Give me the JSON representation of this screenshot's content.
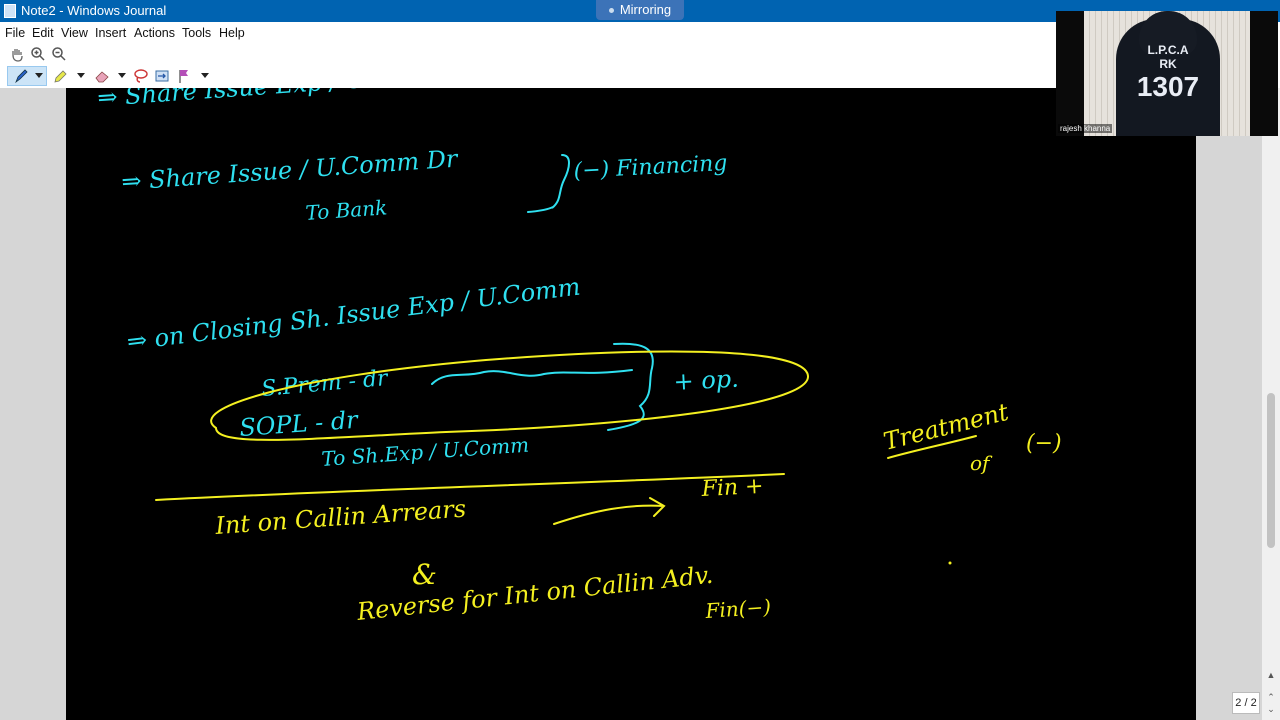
{
  "window": {
    "title": "Note2 - Windows Journal",
    "mirroring_label": "Mirroring"
  },
  "menu": [
    "File",
    "Edit",
    "View",
    "Insert",
    "Actions",
    "Tools",
    "Help"
  ],
  "toolbar1": [
    {
      "icon": "hand-pan-icon"
    },
    {
      "icon": "zoom-in-icon"
    },
    {
      "icon": "zoom-out-icon"
    }
  ],
  "toolbar2": [
    {
      "icon": "pen-icon"
    },
    {
      "icon": "pen-dropdown-icon"
    },
    {
      "icon": "highlighter-icon"
    },
    {
      "icon": "highlighter-dropdown-icon"
    },
    {
      "icon": "eraser-icon"
    },
    {
      "icon": "eraser-dropdown-icon"
    },
    {
      "icon": "lasso-select-icon"
    },
    {
      "icon": "insert-space-icon"
    },
    {
      "icon": "flag-icon"
    },
    {
      "icon": "flag-dropdown-icon"
    }
  ],
  "video": {
    "hoodie_line1": "L.P.C.A",
    "hoodie_line2": "RK",
    "hoodie_line3": "1307",
    "participant_name": "rajesh khanna"
  },
  "page_counter": "2 / 2",
  "notes": {
    "line1": "⇒  Share Issue Exp / U.Comm",
    "line2": "⇒  Share Issue / U.Comm  Dr",
    "line3": "To Bank",
    "line4": "(−) Financing",
    "line5": "⇒  on Closing Sh. Issue Exp / U.Comm",
    "line6": "S.Prem  - dr",
    "line7": "SOPL  - dr",
    "line8": "To  Sh.Exp / U.Comm",
    "line9": "+ op.",
    "line10": "Treatment",
    "line11": "of",
    "line12": "(−)",
    "line13": "Int on Callin Arrears",
    "line14": "Fin +",
    "line15": "&",
    "line16": "Reverse  for   Int on Callin Adv.",
    "line17": "Fin(−)"
  },
  "colors": {
    "ink_cyan": "#2fe0f0",
    "ink_yellow": "#f4f020",
    "titlebar": "#0063b1"
  }
}
